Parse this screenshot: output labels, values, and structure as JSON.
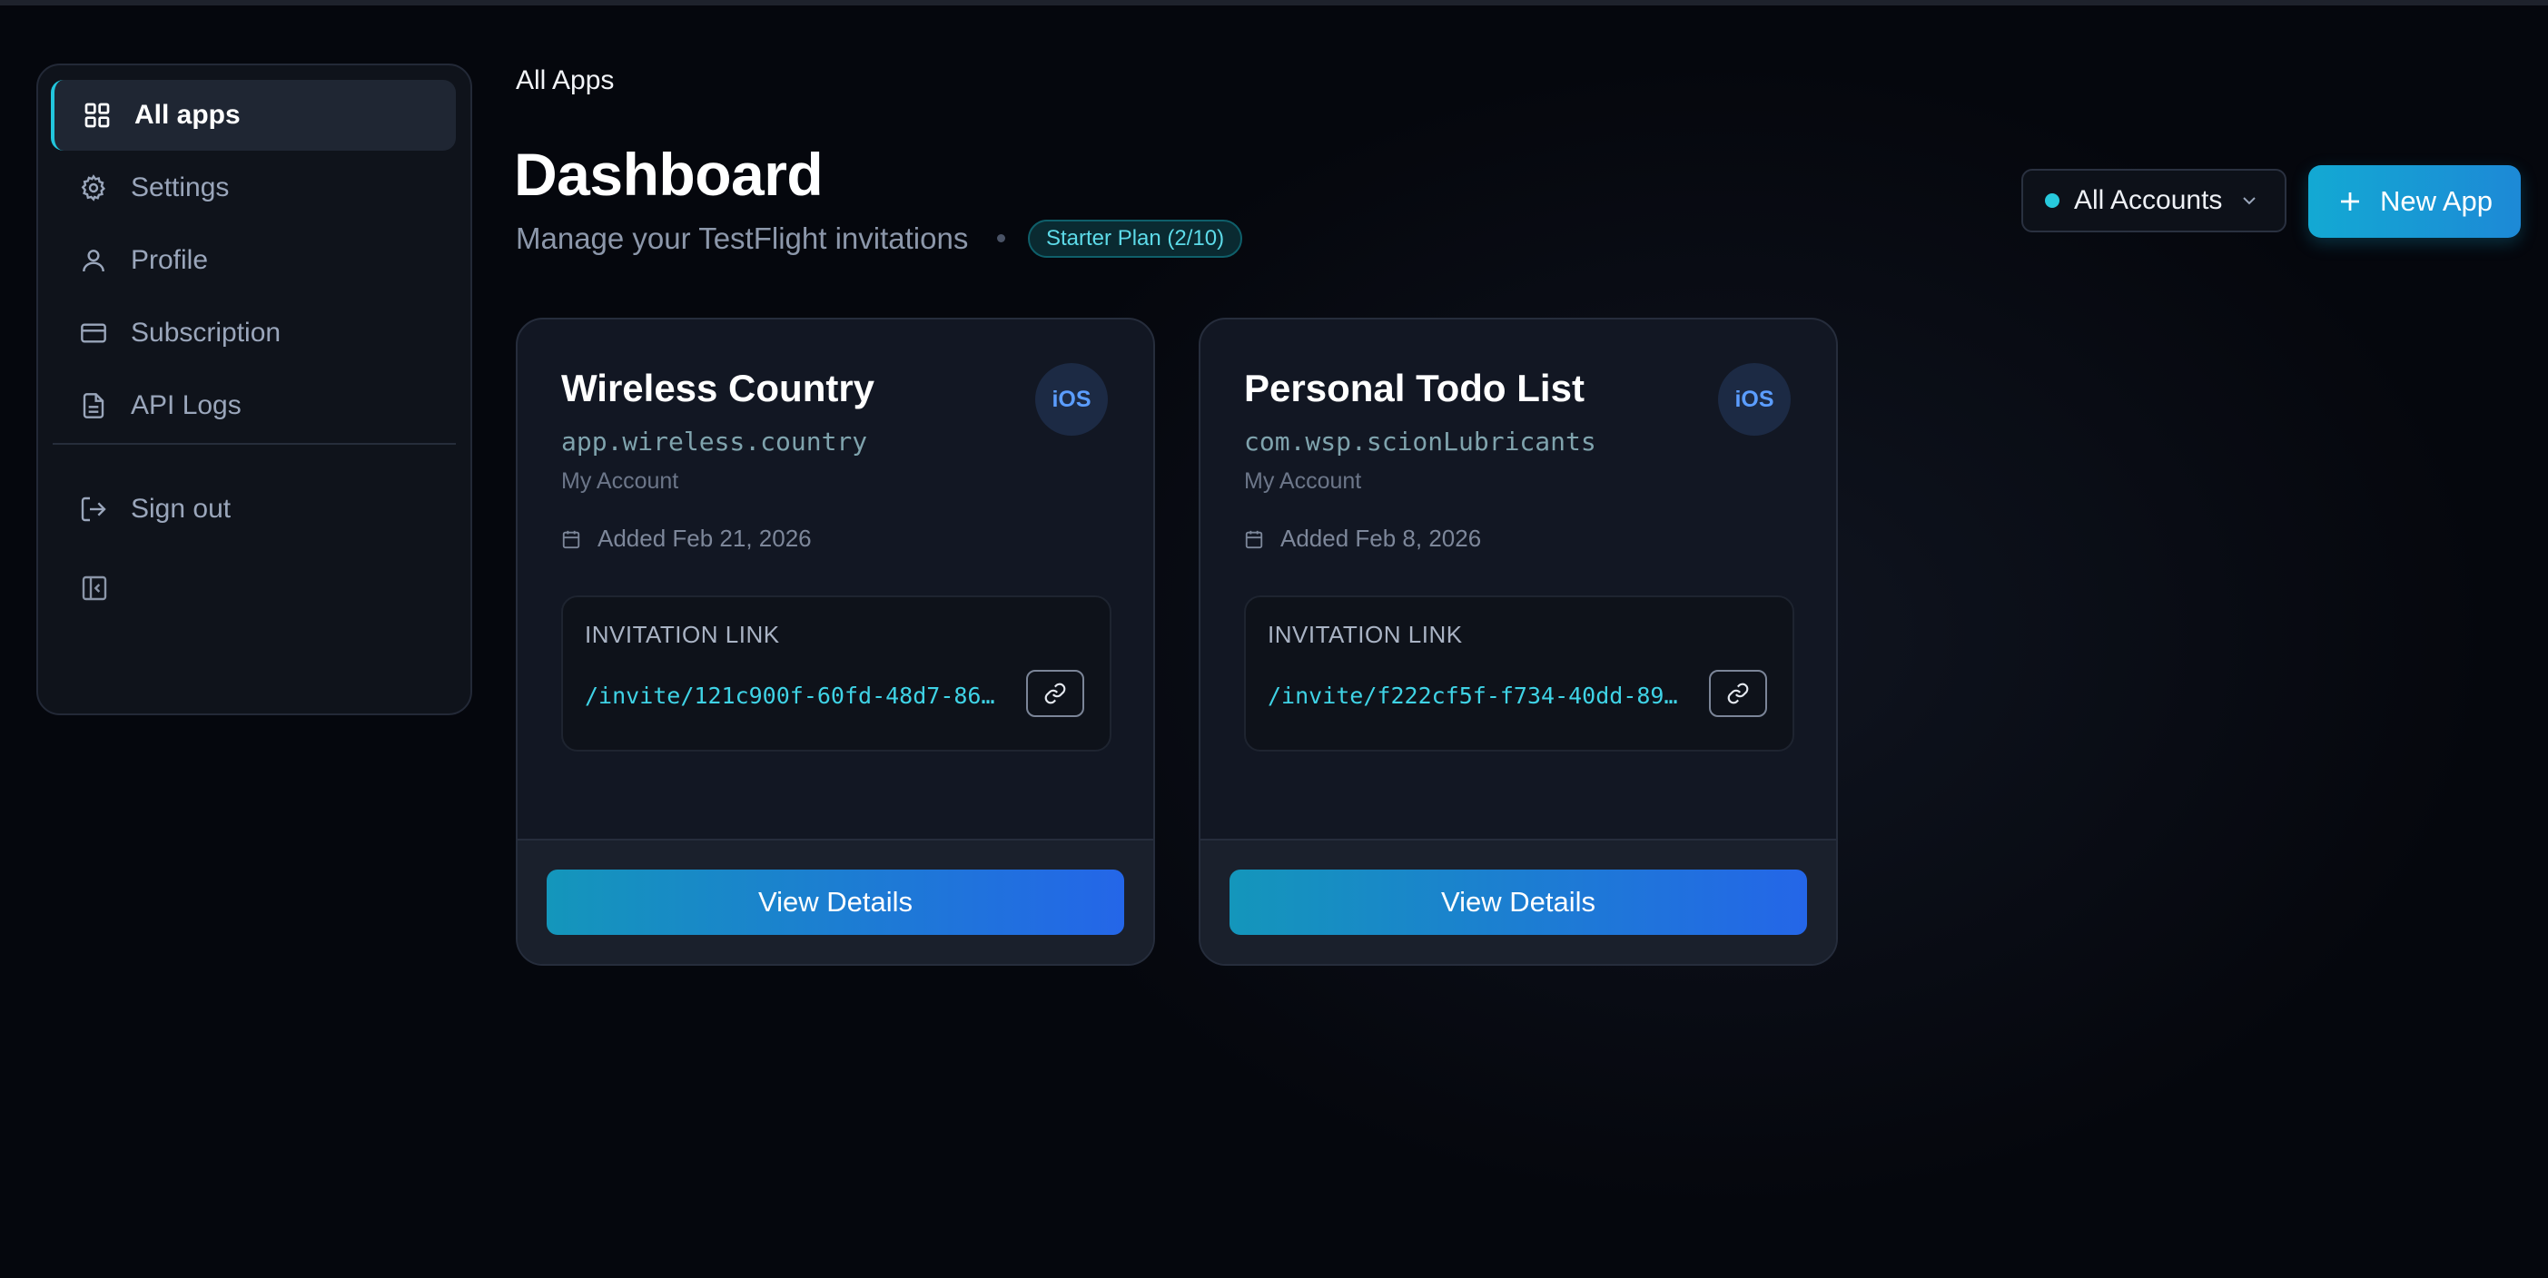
{
  "sidebar": {
    "items": [
      {
        "label": "All apps",
        "icon": "grid-icon",
        "active": true
      },
      {
        "label": "Settings",
        "icon": "gear-icon"
      },
      {
        "label": "Profile",
        "icon": "user-icon"
      },
      {
        "label": "Subscription",
        "icon": "credit-card-icon"
      },
      {
        "label": "API Logs",
        "icon": "file-text-icon"
      }
    ],
    "sign_out": {
      "label": "Sign out",
      "icon": "sign-out-icon"
    },
    "collapse_icon": "sidebar-collapse-icon"
  },
  "header": {
    "breadcrumb": "All Apps",
    "title": "Dashboard",
    "subtitle": "Manage your TestFlight invitations",
    "plan_badge": "Starter Plan (2/10)",
    "accounts_select": "All Accounts",
    "new_app_label": "New App"
  },
  "apps": [
    {
      "name": "Wireless Country",
      "bundle_id": "app.wireless.country",
      "account": "My Account",
      "added": "Added Feb 21, 2026",
      "platform": "iOS",
      "invite_label": "INVITATION LINK",
      "invite_url": "/invite/121c900f-60fd-48d7-860…",
      "action_label": "View Details"
    },
    {
      "name": "Personal Todo List",
      "bundle_id": "com.wsp.scionLubricants",
      "account": "My Account",
      "added": "Added Feb 8, 2026",
      "platform": "iOS",
      "invite_label": "INVITATION LINK",
      "invite_url": "/invite/f222cf5f-f734-40dd-89a…",
      "action_label": "View Details"
    }
  ],
  "colors": {
    "accent": "#22c6dd",
    "background": "#05070d",
    "button_gradient_start": "#1496bb",
    "button_gradient_end": "#2466e8"
  }
}
